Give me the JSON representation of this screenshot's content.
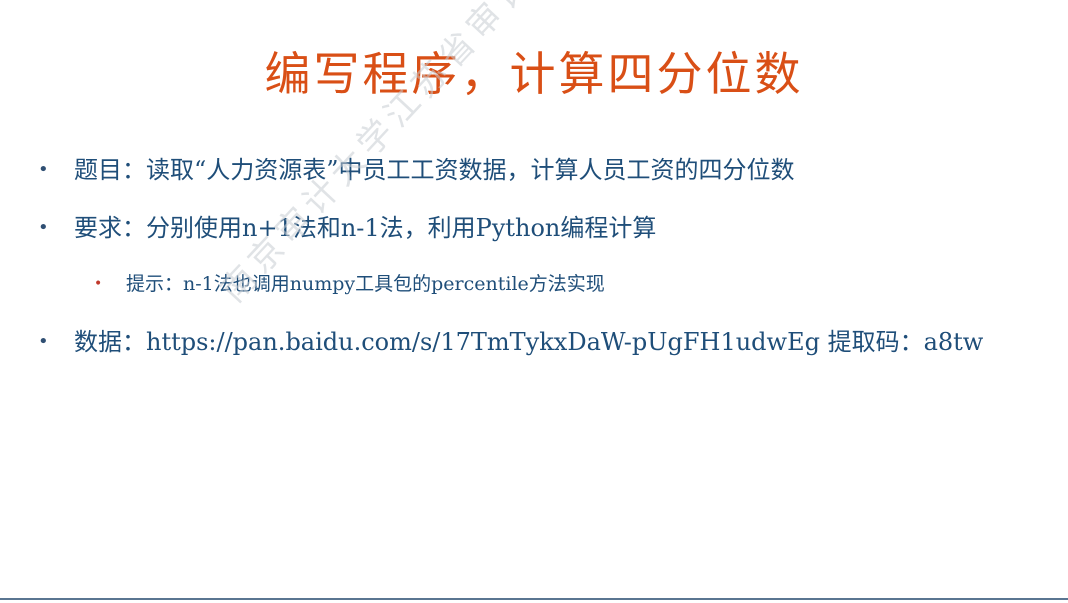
{
  "slide": {
    "title": "编写程序，计算四分位数",
    "bullets": [
      {
        "text": "题目：读取“人力资源表”中员工工资数据，计算人员工资的四分位数"
      },
      {
        "text": "要求：分别使用n+1法和n-1法，利用Python编程计算"
      },
      {
        "text": "提示：n-1法也调用numpy工具包的percentile方法实现"
      },
      {
        "text": "数据：https://pan.baidu.com/s/17TmTykxDaW-pUgFH1udwEg 提取码：a8tw"
      }
    ],
    "bullet_symbol": "•",
    "watermark": "南京审计大学江苏省审计信息工程重点实验室"
  },
  "colors": {
    "title": "#d94f16",
    "body_text": "#1f4e79",
    "sub_bullet": "#c0392b",
    "rule": "#5a7591"
  }
}
